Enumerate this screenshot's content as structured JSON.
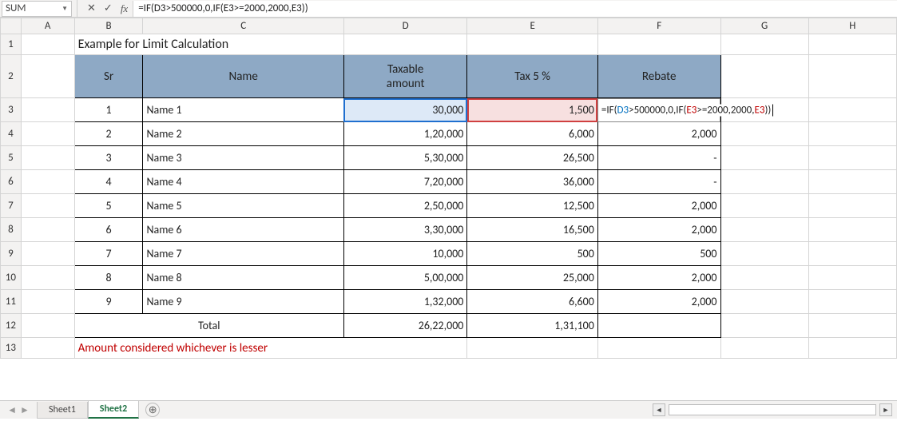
{
  "formula_bar": {
    "namebox": "SUM",
    "cancel_glyph": "✕",
    "accept_glyph": "✓",
    "fx_label": "fx",
    "formula_html": "=IF(D3>500000,0,IF(E3>=2000,2000,E3))"
  },
  "columns": [
    "A",
    "B",
    "C",
    "D",
    "E",
    "F",
    "G",
    "H"
  ],
  "row_numbers": [
    "1",
    "2",
    "3",
    "4",
    "5",
    "6",
    "7",
    "8",
    "9",
    "10",
    "11",
    "12",
    "13"
  ],
  "title": "Example for Limit Calculation",
  "headers": {
    "sr": "Sr",
    "name": "Name",
    "taxable_line1": "Taxable",
    "taxable_line2": "amount",
    "tax": "Tax 5 %",
    "rebate": "Rebate"
  },
  "rows": [
    {
      "sr": "1",
      "name": "Name 1",
      "taxable": "30,000",
      "tax": "1,500",
      "rebate_formula": {
        "pre": "=IF(",
        "ref1": "D3",
        "mid1": ">500000,0,IF(",
        "ref2": "E3",
        "mid2": ">=2000,2000,",
        "ref3": "E3",
        "post": "))"
      }
    },
    {
      "sr": "2",
      "name": "Name 2",
      "taxable": "1,20,000",
      "tax": "6,000",
      "rebate": "2,000"
    },
    {
      "sr": "3",
      "name": "Name 3",
      "taxable": "5,30,000",
      "tax": "26,500",
      "rebate": "-"
    },
    {
      "sr": "4",
      "name": "Name 4",
      "taxable": "7,20,000",
      "tax": "36,000",
      "rebate": "-"
    },
    {
      "sr": "5",
      "name": "Name 5",
      "taxable": "2,50,000",
      "tax": "12,500",
      "rebate": "2,000"
    },
    {
      "sr": "6",
      "name": "Name 6",
      "taxable": "3,30,000",
      "tax": "16,500",
      "rebate": "2,000"
    },
    {
      "sr": "7",
      "name": "Name 7",
      "taxable": "10,000",
      "tax": "500",
      "rebate": "500"
    },
    {
      "sr": "8",
      "name": "Name 8",
      "taxable": "5,00,000",
      "tax": "25,000",
      "rebate": "2,000"
    },
    {
      "sr": "9",
      "name": "Name 9",
      "taxable": "1,32,000",
      "tax": "6,600",
      "rebate": "2,000"
    }
  ],
  "totals": {
    "label": "Total",
    "taxable": "26,22,000",
    "tax": "1,31,100"
  },
  "note": "Amount considered whichever is lesser",
  "tabs": {
    "sheet1": "Sheet1",
    "sheet2": "Sheet2",
    "add_glyph": "⊕"
  },
  "scroll": {
    "left": "◄",
    "right": "►"
  }
}
